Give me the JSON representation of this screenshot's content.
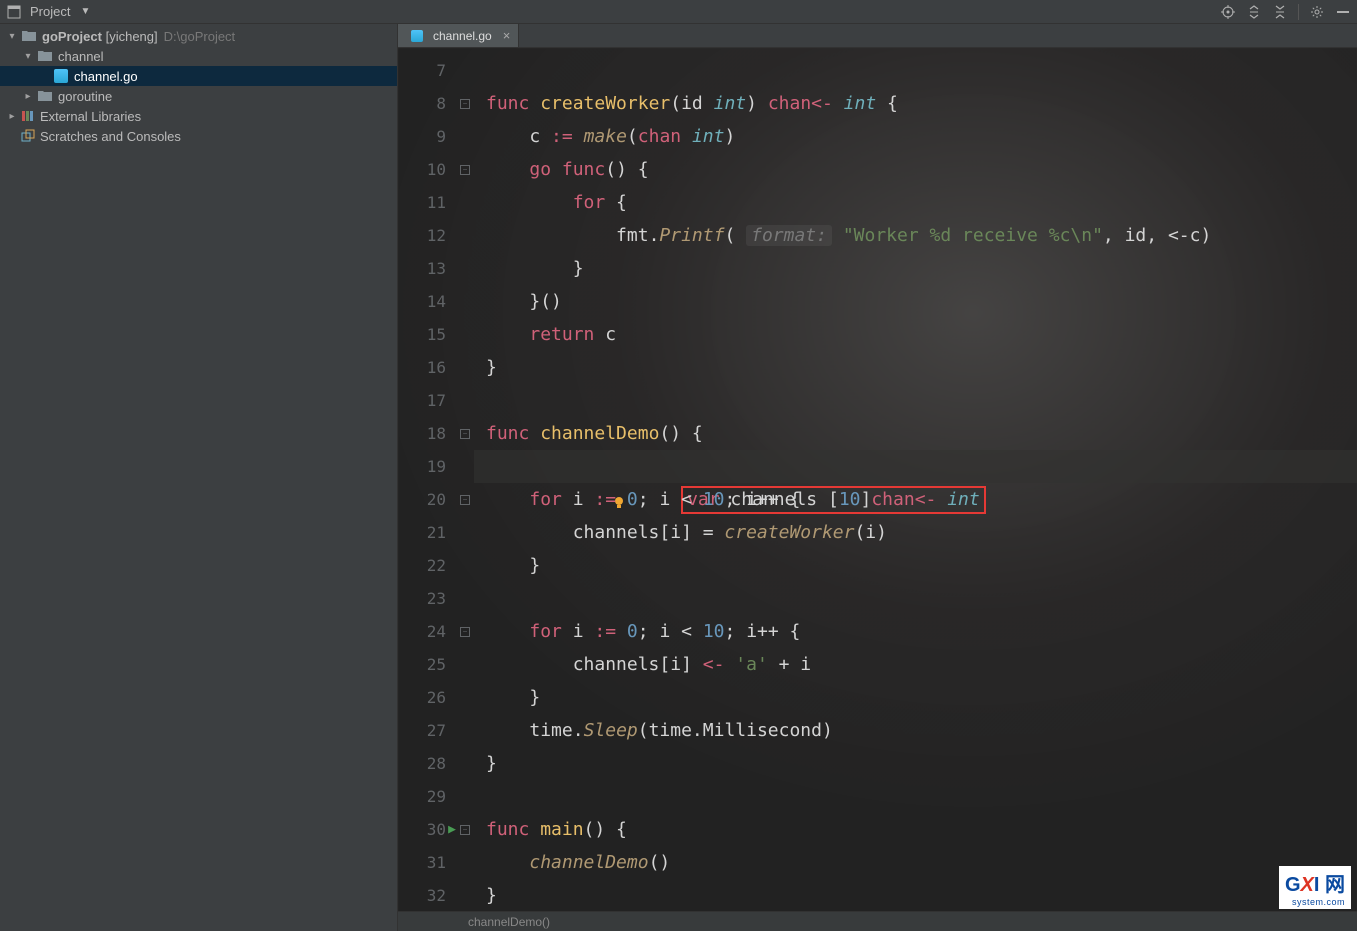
{
  "toolbar": {
    "title": "Project"
  },
  "project_tree": {
    "root": {
      "name": "goProject",
      "branch": "[yicheng]",
      "path": "D:\\goProject"
    },
    "channel": {
      "name": "channel"
    },
    "file": {
      "name": "channel.go"
    },
    "goroutine": {
      "name": "goroutine"
    },
    "external": {
      "name": "External Libraries"
    },
    "scratches": {
      "name": "Scratches and Consoles"
    }
  },
  "tab": {
    "label": "channel.go"
  },
  "line_numbers": [
    "7",
    "8",
    "9",
    "10",
    "11",
    "12",
    "13",
    "14",
    "15",
    "16",
    "17",
    "18",
    "19",
    "20",
    "21",
    "22",
    "23",
    "24",
    "25",
    "26",
    "27",
    "28",
    "29",
    "30",
    "31",
    "32"
  ],
  "code": {
    "l8": {
      "func": "func",
      "name": "createWorker",
      "params": "(id ",
      "type_int": "int",
      "close_p": ") ",
      "chan": "chan<- ",
      "ret_int": "int",
      "brace": " {"
    },
    "l9": {
      "indent": "    ",
      "c": "c ",
      "assign": ":= ",
      "make": "make",
      "p1": "(",
      "chan": "chan ",
      "int": "int",
      "p2": ")"
    },
    "l10": {
      "indent": "    ",
      "go": "go ",
      "func": "func",
      "par": "() {"
    },
    "l11": {
      "indent": "        ",
      "for": "for",
      "brace": " {"
    },
    "l12": {
      "indent": "            ",
      "fmt": "fmt",
      "dot": ".",
      "printf": "Printf",
      "p1": "( ",
      "hint": "format:",
      "sp": " ",
      "str": "\"Worker %d receive %c\\n\"",
      "rest": ", id, <-c)"
    },
    "l13": {
      "indent": "        ",
      "brace": "}"
    },
    "l14": {
      "indent": "    ",
      "brace": "}()"
    },
    "l15": {
      "indent": "    ",
      "ret": "return",
      "c": " c"
    },
    "l16": {
      "brace": "}"
    },
    "l18": {
      "func": "func",
      "name": " channelDemo",
      "rest": "() {"
    },
    "l19": {
      "indent": "    ",
      "var": "var",
      "ch": " channels ",
      "br": "[",
      "n": "10",
      "br2": "]",
      "chan": "chan<-",
      "sp": " ",
      "int": "int"
    },
    "l20": {
      "indent": "    ",
      "for": "for",
      "i": " i ",
      "assign": ":= ",
      "zero": "0",
      "semi": "; ",
      "i2": "i ",
      "lt": "< ",
      "ten": "10",
      "semi2": "; ",
      "i3": "i",
      "pp": "++",
      "brace": " {"
    },
    "l21": {
      "indent": "        ",
      "ch": "channels[i] = ",
      "call": "createWorker",
      "arg": "(i)"
    },
    "l22": {
      "indent": "    ",
      "brace": "}"
    },
    "l24": {
      "indent": "    ",
      "for": "for",
      "i": " i ",
      "assign": ":= ",
      "zero": "0",
      "semi": "; ",
      "i2": "i ",
      "lt": "< ",
      "ten": "10",
      "semi2": "; ",
      "i3": "i",
      "pp": "++",
      "brace": " {"
    },
    "l25": {
      "indent": "        ",
      "ch": "channels[i] ",
      "arrow": "<-",
      "sp": " ",
      "a": "'a'",
      "plus": " + i"
    },
    "l26": {
      "indent": "    ",
      "brace": "}"
    },
    "l27": {
      "indent": "    ",
      "time": "time",
      "dot": ".",
      "sleep": "Sleep",
      "arg": "(time.Millisecond)"
    },
    "l28": {
      "brace": "}"
    },
    "l30": {
      "func": "func",
      "name": " main",
      "rest": "() {"
    },
    "l31": {
      "indent": "    ",
      "call": "channelDemo",
      "arg": "()"
    },
    "l32": {
      "brace": "}"
    }
  },
  "breadcrumb": "channelDemo()",
  "watermark": {
    "brand": "GXI",
    "sub": "system.com",
    "suffix": "网"
  }
}
